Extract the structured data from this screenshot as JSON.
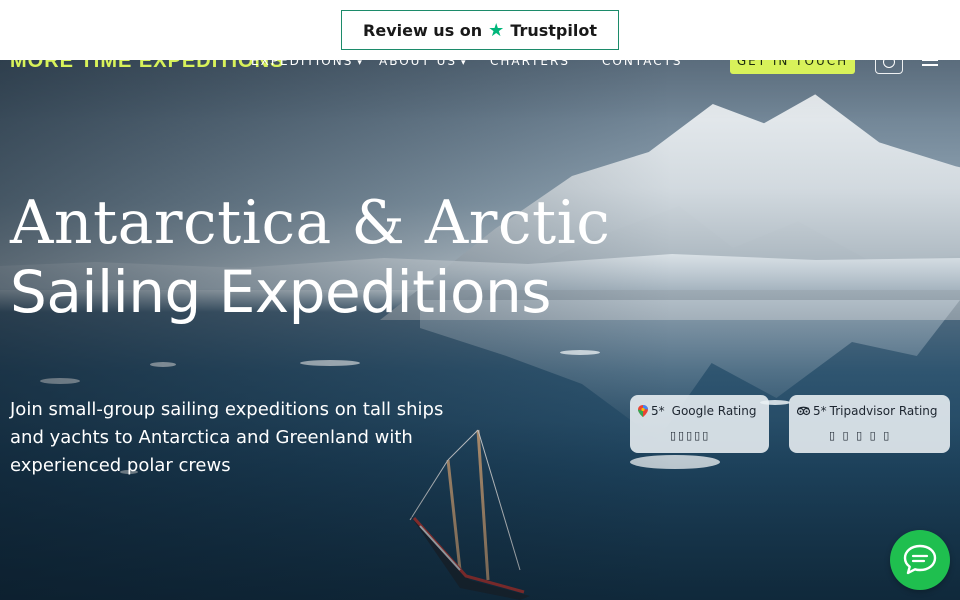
{
  "trustpilot": {
    "prefix": "Review us on",
    "brand": "Trustpilot",
    "star_color": "#00b67a"
  },
  "header": {
    "brand": "MORE TIME EXPEDITIONS",
    "nav": [
      {
        "label": "EXPEDITIONS",
        "has_dropdown": true
      },
      {
        "label": "ABOUT US",
        "has_dropdown": true
      },
      {
        "label": "CHARTERS",
        "has_dropdown": false
      },
      {
        "label": "CONTACTS",
        "has_dropdown": false
      }
    ],
    "cta_label": "GET IN TOUCH",
    "accent_color": "#d8f25a",
    "icons": {
      "account": "user-icon",
      "menu": "hamburger-menu-icon"
    }
  },
  "hero": {
    "title_line1": "Antarctica & Arctic",
    "title_line2": "Sailing Expeditions",
    "subtitle": "Join small-group sailing expeditions on tall ships and yachts to Antarctica and Greenland with experienced polar crews"
  },
  "ratings": [
    {
      "icon": "google-maps-pin-icon",
      "score": "5*",
      "label": "Google Rating",
      "stars": "▯▯▯▯▯"
    },
    {
      "icon": "tripadvisor-owl-icon",
      "score": "5*",
      "label": "Tripadvisor Rating",
      "stars": "▯ ▯ ▯ ▯ ▯"
    }
  ],
  "chat": {
    "icon": "chat-bubble-icon",
    "color": "#1fbf4f"
  }
}
